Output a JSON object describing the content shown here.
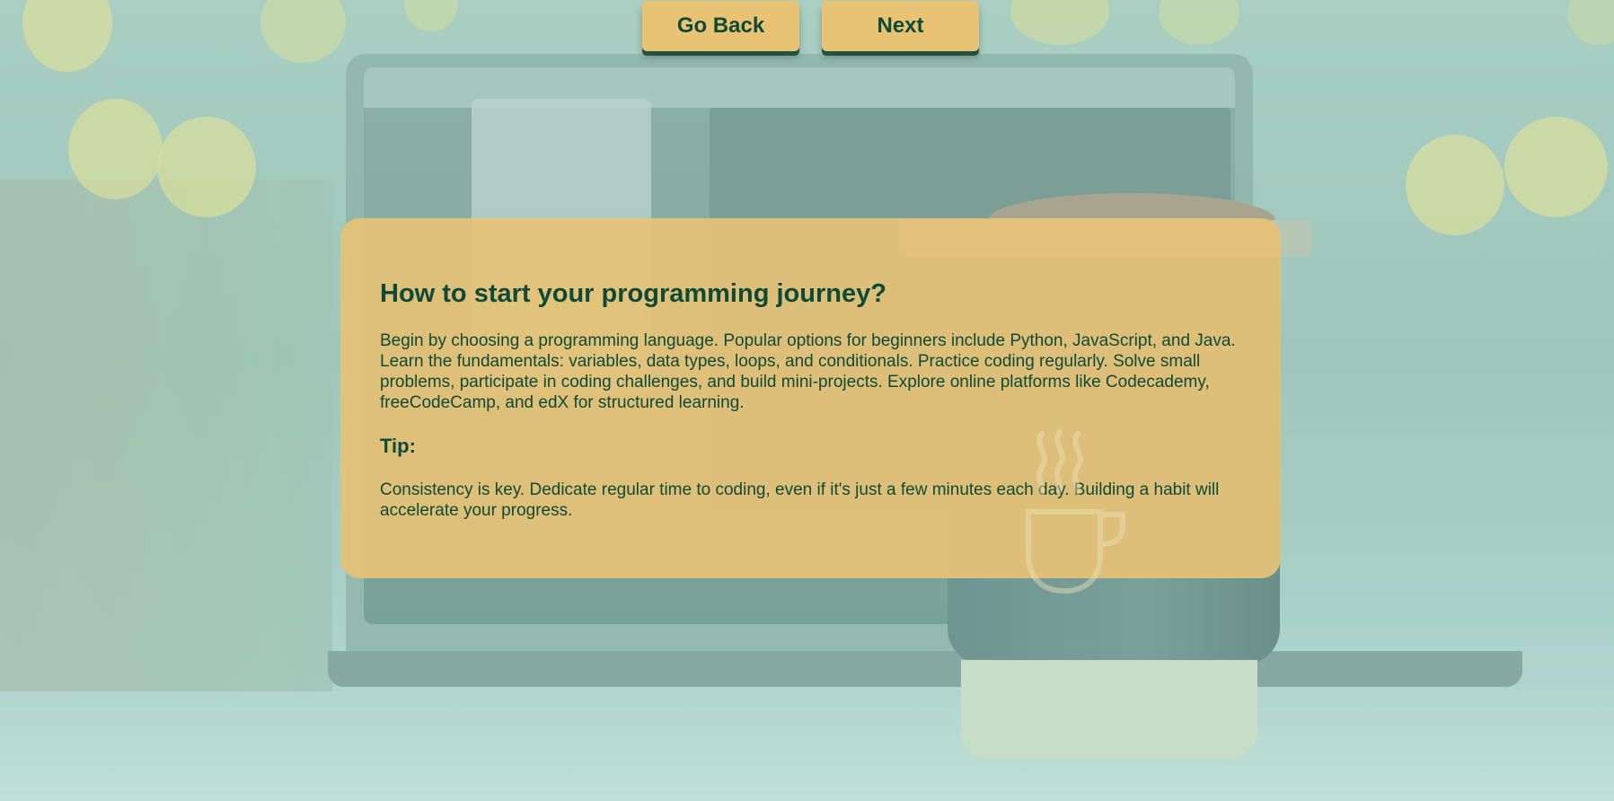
{
  "nav": {
    "back_label": "Go Back",
    "next_label": "Next"
  },
  "card": {
    "title": "How to start your programming journey?",
    "body": "Begin by choosing a programming language. Popular options for beginners include Python, JavaScript, and Java. Learn the fundamentals: variables, data types, loops, and conditionals. Practice coding regularly. Solve small problems, participate in coding challenges, and build mini-projects. Explore online platforms like Codecademy, freeCodeCamp, and edX for structured learning.",
    "tip_heading": "Tip:",
    "tip_body": "Consistency is key. Dedicate regular time to coding, even if it's just a few minutes each day. Building a habit will accelerate your progress."
  },
  "icons": {
    "decoration": "coffee-cup-icon"
  },
  "colors": {
    "card_background": "#e5c276",
    "button_background": "#e7c373",
    "text": "#0f4a36",
    "page_overlay": "#a9cfc3"
  }
}
